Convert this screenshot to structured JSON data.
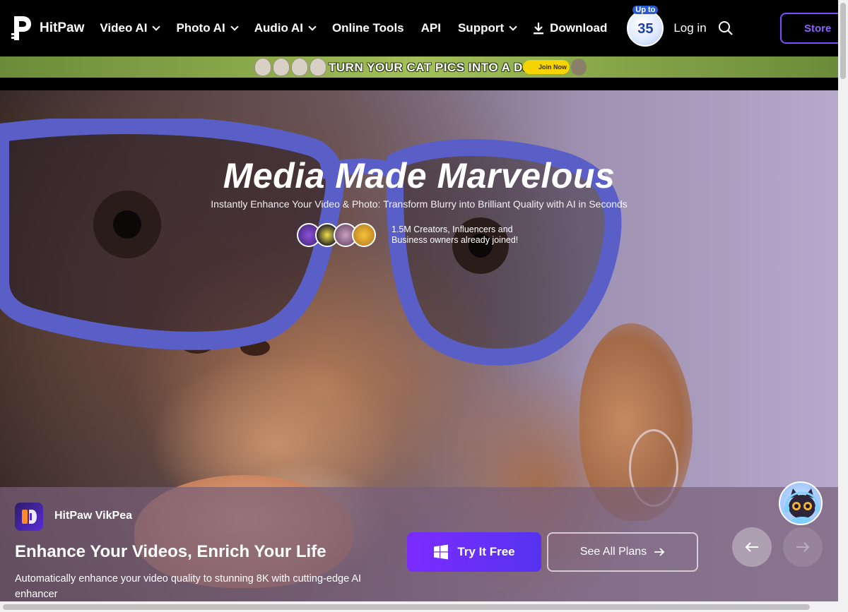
{
  "nav": {
    "brand": "HitPaw",
    "menu": [
      {
        "label": "Video AI",
        "has_dropdown": true
      },
      {
        "label": "Photo AI",
        "has_dropdown": true
      },
      {
        "label": "Audio AI",
        "has_dropdown": true
      },
      {
        "label": "Online Tools",
        "has_dropdown": false
      },
      {
        "label": "API",
        "has_dropdown": false
      },
      {
        "label": "Support",
        "has_dropdown": true
      }
    ],
    "download_label": "Download",
    "promo_top": "Up to",
    "promo_value": "35",
    "login_label": "Log in",
    "store_label": "Store",
    "accent_color": "#7b4dff"
  },
  "banner": {
    "text": "TURN YOUR CAT PICS INTO A DJI",
    "join_label": "Join Now"
  },
  "hero": {
    "title": "Media Made Marvelous",
    "subtitle": "Instantly Enhance Your Video & Photo: Transform Blurry into Brilliant Quality with AI in Seconds",
    "social_line1": "1.5M Creators, Influencers and",
    "social_line2": "Business owners already joined!"
  },
  "product": {
    "name": "HitPaw VikPea",
    "headline": "Enhance Your Videos, Enrich Your Life",
    "description": "Automatically enhance your video quality to stunning 8K with cutting-edge AI enhancer",
    "try_label": "Try It Free",
    "plans_label": "See All Plans"
  },
  "icons": {
    "logo": "hitpaw-logo-icon",
    "download": "download-icon",
    "search": "search-icon",
    "windows": "windows-icon",
    "arrow_right": "arrow-right-icon",
    "prev": "arrow-left-icon",
    "next": "arrow-right-icon"
  }
}
